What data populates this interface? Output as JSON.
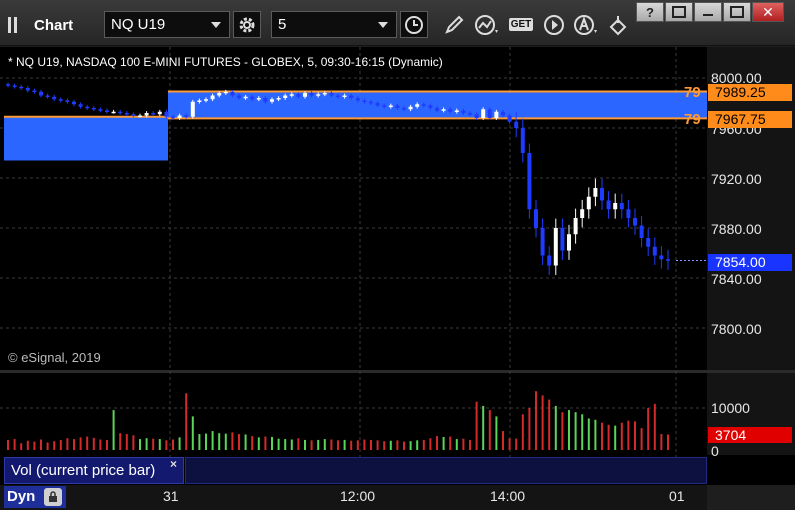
{
  "app": {
    "title": "Chart"
  },
  "toolbar": {
    "symbol": "NQ U19",
    "interval": "5",
    "get_label": "GET"
  },
  "chart": {
    "header": "* NQ U19, NASDAQ 100 E-MINI FUTURES - GLOBEX, 5, 09:30-16:15 (Dynamic)",
    "copyright": "© eSignal, 2019",
    "levels": [
      {
        "number": "79",
        "price": "7989.25"
      },
      {
        "number": "79",
        "price": "7967.75"
      }
    ],
    "last_price": "7854.00",
    "volume_label": "3704",
    "study_label": "Vol (current price bar)",
    "study_close": "×",
    "dyn_label": "Dyn",
    "colors": {
      "up": "#ffffff",
      "down": "#1f3bff",
      "zone": "#2a66ff",
      "level": "#ff9933",
      "vol_up": "#59d659",
      "vol_down": "#d42a2a"
    }
  },
  "chart_data": {
    "type": "candlestick",
    "price_axis": {
      "ticks": [
        "8000.00",
        "7960.00",
        "7920.00",
        "7880.00",
        "7840.00",
        "7800.00"
      ],
      "range": [
        7775,
        8010
      ]
    },
    "volume_axis": {
      "ticks": [
        "10000",
        "0"
      ],
      "range": [
        0,
        14000
      ]
    },
    "time_axis": {
      "ticks": [
        "31",
        "12:00",
        "14:00",
        "01"
      ]
    },
    "zones": [
      {
        "from": 7934,
        "to": 7969
      },
      {
        "from": 7967.75,
        "to": 7989.25
      }
    ],
    "close_series_approx": [
      7994,
      7993,
      7992,
      7990,
      7989,
      7986,
      7985,
      7983,
      7982,
      7981,
      7979,
      7977,
      7976,
      7975,
      7974,
      7973,
      7973,
      7972,
      7971,
      7970,
      7970,
      7972,
      7971,
      7973,
      7969,
      7968,
      7970,
      7969,
      7981,
      7982,
      7983,
      7986,
      7988,
      7989,
      7986,
      7984,
      7985,
      7983,
      7984,
      7981,
      7983,
      7984,
      7986,
      7987,
      7985,
      7988,
      7986,
      7987,
      7988,
      7986,
      7985,
      7986,
      7984,
      7982,
      7981,
      7980,
      7978,
      7977,
      7978,
      7976,
      7975,
      7977,
      7979,
      7978,
      7976,
      7974,
      7975,
      7973,
      7974,
      7972,
      7971,
      7968,
      7975,
      7968,
      7973,
      7970,
      7965,
      7960,
      7940,
      7895,
      7880,
      7858,
      7850,
      7880,
      7862,
      7875,
      7888,
      7895,
      7905,
      7912,
      7902,
      7895,
      7900,
      7895,
      7888,
      7882,
      7872,
      7865,
      7858,
      7855,
      7854
    ],
    "volume_approx": [
      2400,
      2600,
      1600,
      2200,
      2000,
      2500,
      1800,
      2100,
      2400,
      2800,
      2600,
      3000,
      3200,
      2900,
      2500,
      2400,
      9500,
      4000,
      3800,
      3500,
      2600,
      2800,
      2700,
      2600,
      2300,
      2500,
      3000,
      13500,
      8000,
      3800,
      3900,
      4500,
      4000,
      3900,
      4200,
      3800,
      3700,
      3300,
      3000,
      3200,
      3100,
      2700,
      2600,
      2500,
      2800,
      2400,
      2300,
      2400,
      2600,
      2500,
      2300,
      2400,
      2200,
      2300,
      2500,
      2400,
      2300,
      2100,
      2200,
      2300,
      2000,
      2100,
      2300,
      2400,
      2800,
      3300,
      3100,
      3200,
      2600,
      2700,
      2400,
      11500,
      10500,
      9500,
      8000,
      4500,
      2800,
      2700,
      8500,
      10000,
      14000,
      13000,
      12000,
      10500,
      9000,
      9500,
      9000,
      8500,
      7500,
      7200,
      6500,
      6000,
      5800,
      6500,
      7000,
      6800,
      5200,
      10000,
      11000,
      3800,
      3704
    ]
  }
}
